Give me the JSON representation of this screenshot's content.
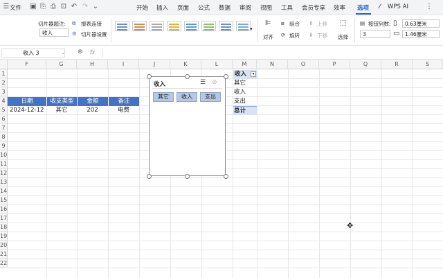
{
  "menubar": {
    "file_label": "文件",
    "tabs": [
      "开始",
      "插入",
      "页面",
      "公式",
      "数据",
      "审阅",
      "视图",
      "工具",
      "会员专享",
      "效率",
      "选项"
    ],
    "active_tab": "选项",
    "wps_ai": "WPS AI"
  },
  "ribbon": {
    "slicer_caption_label": "切片器题注:",
    "slicer_caption_value": "收入",
    "report_link": "报表连接",
    "slicer_settings": "切片器设置",
    "align": "对齐",
    "group": "组合",
    "rotate": "旋转",
    "bring_forward": "上移",
    "send_backward": "下移",
    "select": "选择",
    "columns_label": "按钮列数:",
    "columns_value": "3",
    "height_value": "0.63厘米",
    "width_value": "1.46厘米"
  },
  "formula_bar": {
    "name_box": "收入 3",
    "fx": "fx",
    "zoom_icon": "zoom-icon"
  },
  "grid": {
    "columns": [
      "F",
      "G",
      "H",
      "I",
      "J",
      "K",
      "L",
      "M",
      "N",
      "O",
      "P",
      "Q",
      "R",
      "S"
    ],
    "rows": [
      "1",
      "2",
      "3",
      "4",
      "5",
      "6",
      "7",
      "8",
      "9",
      "10",
      "11",
      "12",
      "13",
      "14",
      "15",
      "16",
      "17",
      "18",
      "19",
      "20",
      "21",
      "22"
    ],
    "table_headers": [
      "日期",
      "收支类型",
      "金额",
      "备注"
    ],
    "table_row": [
      "2024-12-12",
      "其它",
      "202",
      "电费"
    ],
    "pivot": {
      "header": "收入",
      "items": [
        "其它",
        "收入",
        "支出"
      ],
      "total": "总计",
      "filter_icon": "dropdown-icon"
    }
  },
  "slicer": {
    "title": "收入",
    "buttons": [
      "其它",
      "收入",
      "支出"
    ]
  }
}
